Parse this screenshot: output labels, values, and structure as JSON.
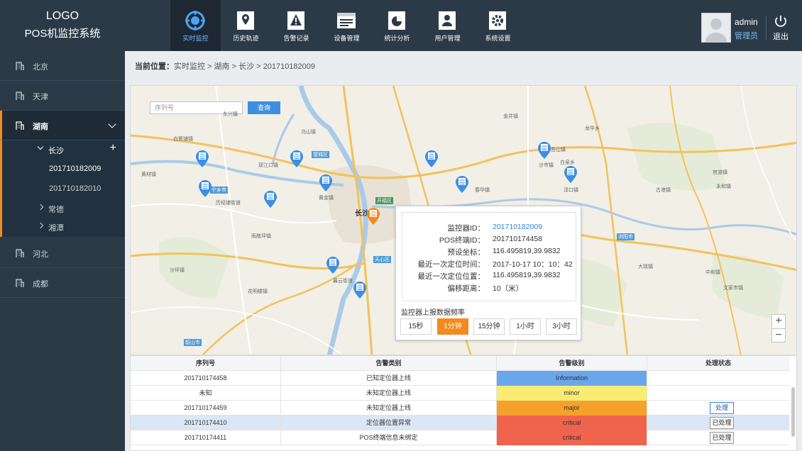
{
  "header": {
    "logo_line1": "LOGO",
    "logo_line2": "POS机监控系统",
    "nav": [
      {
        "label": "实时监控",
        "icon": "target-icon",
        "active": true
      },
      {
        "label": "历史轨迹",
        "icon": "map-pin-icon"
      },
      {
        "label": "告警记录",
        "icon": "warning-icon"
      },
      {
        "label": "设备管理",
        "icon": "device-icon"
      },
      {
        "label": "统计分析",
        "icon": "pie-chart-icon"
      },
      {
        "label": "用户管理",
        "icon": "user-icon"
      },
      {
        "label": "系统设置",
        "icon": "settings-icon"
      }
    ],
    "user_name": "admin",
    "user_role": "管理员",
    "logout_label": "退出"
  },
  "sidebar": {
    "items": [
      {
        "label": "北京"
      },
      {
        "label": "天津"
      },
      {
        "label": "湖南"
      },
      {
        "label": "河北"
      },
      {
        "label": "成都"
      }
    ],
    "sub": {
      "changsha": "长沙",
      "leaf1": "201710182009",
      "leaf2": "201710182010",
      "changde": "常德",
      "xiangtan": "湘潭"
    }
  },
  "breadcrumb": {
    "prefix": "当前位置：",
    "path": "实时监控  > 湖南 > 长沙 > 201710182009"
  },
  "map": {
    "search_placeholder": "序列号",
    "query_label": "查询",
    "city": "长沙",
    "labels": {
      "l1": "望城区",
      "l2": "开福区",
      "l3": "天心区",
      "l4": "浏阳市",
      "l5": "韶山市",
      "l6": "宁乡市",
      "t1": "白箬铺镇",
      "t2": "双江口镇",
      "t3": "黄金镇",
      "t4": "春华镇",
      "t5": "沙市镇",
      "t6": "淳口镇",
      "t7": "历经铺街道",
      "t8": "雨敞坪镇",
      "t9": "花明楼镇",
      "t10": "金井镇",
      "t11": "大瑶镇",
      "t12": "永和镇",
      "t13": "官渡镇",
      "t14": "古港镇",
      "t15": "中和镇",
      "t16": "文家市镇",
      "t17": "暮云街道",
      "t18": "白泉乡",
      "t19": "龙华乡",
      "t20": "道吾山镇",
      "t21": "东兴镇",
      "t22": "乌山镇",
      "t23": "黄材镇",
      "t24": "沙坪镇"
    },
    "zoom_in": "+",
    "zoom_out": "−"
  },
  "popup": {
    "rows": [
      {
        "k": "监控器ID：",
        "v": "201710182009",
        "link": true
      },
      {
        "k": "POS终端ID：",
        "v": "201710174458"
      },
      {
        "k": "预设坐标：",
        "v": "116.495819,39.9832"
      },
      {
        "k": "最近一次定位时间：",
        "v": "2017-10-17 10：10：42"
      },
      {
        "k": "最近一次定位位置：",
        "v": "116.495819,39.9832"
      },
      {
        "k": "偏移距离：",
        "v": "10（米）"
      }
    ],
    "freq_title": "监控器上报数据频率",
    "freq_options": [
      "15秒",
      "1分钟",
      "15分钟",
      "1小时",
      "3小时"
    ],
    "freq_selected": "1分钟"
  },
  "table": {
    "headers": [
      "序列号",
      "告警类别",
      "告警级别",
      "处理状态"
    ],
    "rows": [
      {
        "serial": "201710174458",
        "type": "已知定位器上线",
        "level": "Information",
        "level_class": "info",
        "action": ""
      },
      {
        "serial": "未知",
        "type": "未知定位器上线",
        "level": "minor",
        "level_class": "minor",
        "action": ""
      },
      {
        "serial": "201710174459",
        "type": "未知定位器上线",
        "level": "major",
        "level_class": "major",
        "action": "处理"
      },
      {
        "serial": "201710174410",
        "type": "定位器位置异常",
        "level": "critical",
        "level_class": "critical",
        "action": "已处理"
      },
      {
        "serial": "201710174411",
        "type": "POS终端信息未绑定",
        "level": "critical",
        "level_class": "critical",
        "action": "已处理"
      }
    ]
  },
  "colors": {
    "header_bg": "#2c3a47",
    "accent_orange": "#f28a1d",
    "accent_blue": "#3d8fe0",
    "info": "#6aa6ec",
    "minor": "#f8ec74",
    "major": "#f5a12c",
    "critical": "#f0634c"
  }
}
